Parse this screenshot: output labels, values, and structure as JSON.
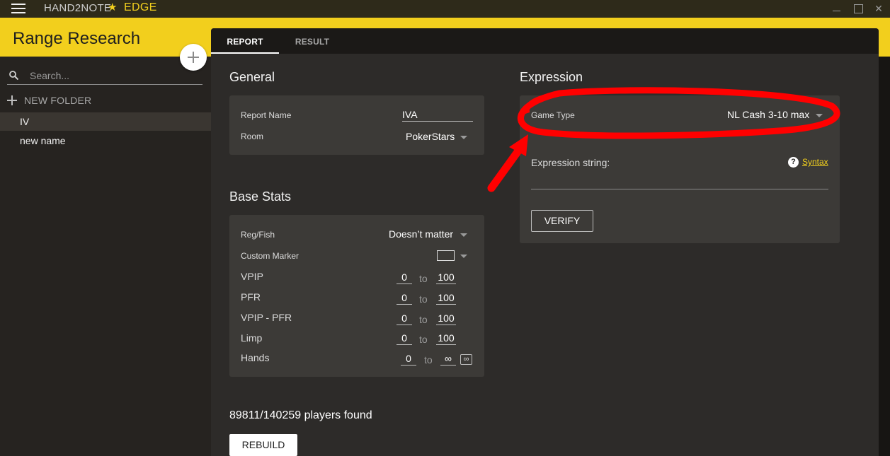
{
  "app": {
    "name": "HAND2NOTE",
    "edition": "EDGE"
  },
  "window_controls": {
    "minimize": "",
    "maximize": "",
    "close": "✕"
  },
  "page_title": "Range Research",
  "sidebar": {
    "search_placeholder": "Search...",
    "new_folder_label": "NEW FOLDER",
    "folders": [
      {
        "label": "IV",
        "selected": true
      },
      {
        "label": "new name",
        "selected": false
      }
    ]
  },
  "tabs": [
    {
      "label": "REPORT",
      "active": true
    },
    {
      "label": "RESULT",
      "active": false
    }
  ],
  "general": {
    "title": "General",
    "report_name_label": "Report Name",
    "report_name_value": "IVA",
    "room_label": "Room",
    "room_value": "PokerStars"
  },
  "base_stats": {
    "title": "Base Stats",
    "reg_fish_label": "Reg/Fish",
    "reg_fish_value": "Doesn’t matter",
    "custom_marker_label": "Custom Marker",
    "to_label": "to",
    "rows": [
      {
        "label": "VPIP",
        "min": "0",
        "max": "100"
      },
      {
        "label": "PFR",
        "min": "0",
        "max": "100"
      },
      {
        "label": "VPIP - PFR",
        "min": "0",
        "max": "100"
      },
      {
        "label": "Limp",
        "min": "0",
        "max": "100"
      },
      {
        "label": "Hands",
        "min": "0",
        "max": "∞"
      }
    ],
    "infinity_toggle": "∞"
  },
  "players_found": "89811/140259 players found",
  "rebuild_label": "REBUILD",
  "expression": {
    "title": "Expression",
    "game_type_label": "Game Type",
    "game_type_value": "NL Cash 3-10 max",
    "expression_string_label": "Expression string:",
    "help_glyph": "?",
    "syntax_link": "Syntax",
    "verify_label": "VERIFY"
  },
  "colors": {
    "accent_yellow": "#f2cf1d",
    "annotation_red": "#ff0000",
    "panel_bg": "#2d2b29",
    "card_bg": "#3c3a37"
  },
  "icons": [
    "hamburger-icon",
    "star-icon",
    "search-icon",
    "plus-icon",
    "caret-down-icon",
    "help-icon",
    "infinity-icon"
  ]
}
